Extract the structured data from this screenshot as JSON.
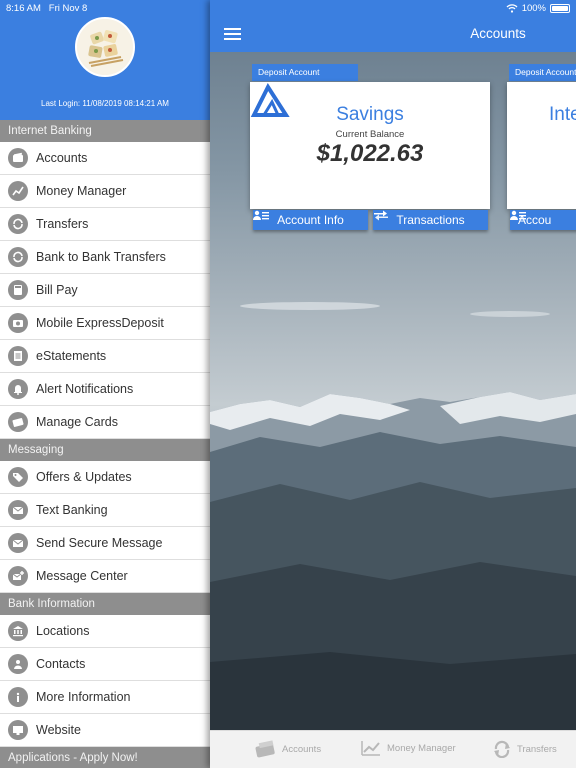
{
  "status": {
    "time": "8:16 AM",
    "date": "Fri Nov 8",
    "battery": "100%"
  },
  "profile": {
    "last_login": "Last Login: 11/08/2019 08:14:21 AM"
  },
  "sidebar": {
    "sections": [
      {
        "title": "Internet Banking"
      },
      {
        "title": "Messaging"
      },
      {
        "title": "Bank Information"
      },
      {
        "title": "Applications - Apply Now!"
      }
    ],
    "items": [
      {
        "label": "Accounts"
      },
      {
        "label": "Money Manager"
      },
      {
        "label": "Transfers"
      },
      {
        "label": "Bank to Bank Transfers"
      },
      {
        "label": "Bill Pay"
      },
      {
        "label": "Mobile ExpressDeposit"
      },
      {
        "label": "eStatements"
      },
      {
        "label": "Alert Notifications"
      },
      {
        "label": "Manage Cards"
      },
      {
        "label": "Offers & Updates"
      },
      {
        "label": "Text Banking"
      },
      {
        "label": "Send Secure Message"
      },
      {
        "label": "Message Center"
      },
      {
        "label": "Locations"
      },
      {
        "label": "Contacts"
      },
      {
        "label": "More Information"
      },
      {
        "label": "Website"
      }
    ]
  },
  "header": {
    "title": "Accounts"
  },
  "cards": [
    {
      "tab_label": "Deposit Account",
      "name": "Savings",
      "balance_label": "Current Balance",
      "balance": "$1,022.63",
      "info_button": "Account Info",
      "transactions_button": "Transactions"
    },
    {
      "tab_label": "Deposit Account",
      "name": "Inte",
      "info_button": "Accou"
    }
  ],
  "tabbar": [
    {
      "label": "Accounts"
    },
    {
      "label": "Money Manager"
    },
    {
      "label": "Transfers"
    }
  ],
  "colors": {
    "primary": "#3b7fe0",
    "section_header": "#8e8e8e",
    "icon_circle": "#8f8f8f"
  }
}
